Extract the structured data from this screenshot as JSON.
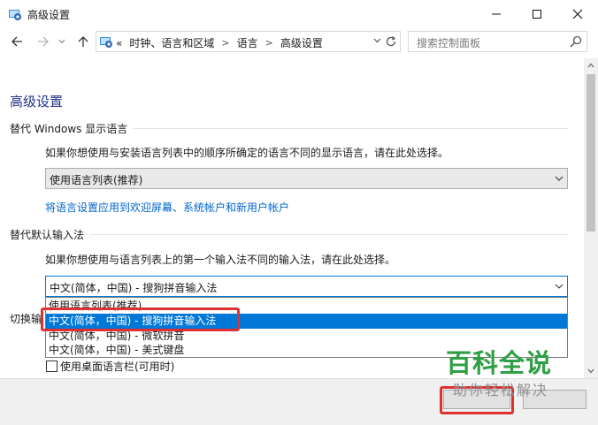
{
  "window": {
    "title": "高级设置",
    "icon": "control-panel-icon"
  },
  "navigation": {
    "breadcrumb_prefix": "«",
    "breadcrumbs": [
      "时钟、语言和区域",
      "语言",
      "高级设置"
    ],
    "search_placeholder": "搜索控制面板"
  },
  "page": {
    "heading": "高级设置",
    "display_language": {
      "title": "替代 Windows 显示语言",
      "description": "如果你想使用与安装语言列表中的顺序所确定的语言不同的显示语言，请在此处选择。",
      "selected": "使用语言列表(推荐)",
      "apply_link": "将语言设置应用到欢迎屏幕、系统帐户和新用户帐户"
    },
    "default_input": {
      "title": "替代默认输入法",
      "description": "如果你想使用与语言列表上的第一个输入法不同的输入法，请在此处选择。",
      "selected": "中文(简体，中国) - 搜狗拼音输入法",
      "options": [
        "使用语言列表(推荐)",
        "中文(简体，中国) - 搜狗拼音输入法",
        "中文(简体，中国) - 微软拼音",
        "中文(简体，中国) - 美式键盘"
      ],
      "highlighted_index": 1
    },
    "switch_section_partial": "切换输",
    "checkbox_label": "使用桌面语言栏(可用时)"
  },
  "watermark": {
    "title": "百科全说",
    "subtitle": "助你轻松解决"
  },
  "colors": {
    "accent": "#0078d7",
    "heading": "#1e3287",
    "link": "#0066cc",
    "highlight_box": "#e03030",
    "watermark": "#2ea043"
  }
}
